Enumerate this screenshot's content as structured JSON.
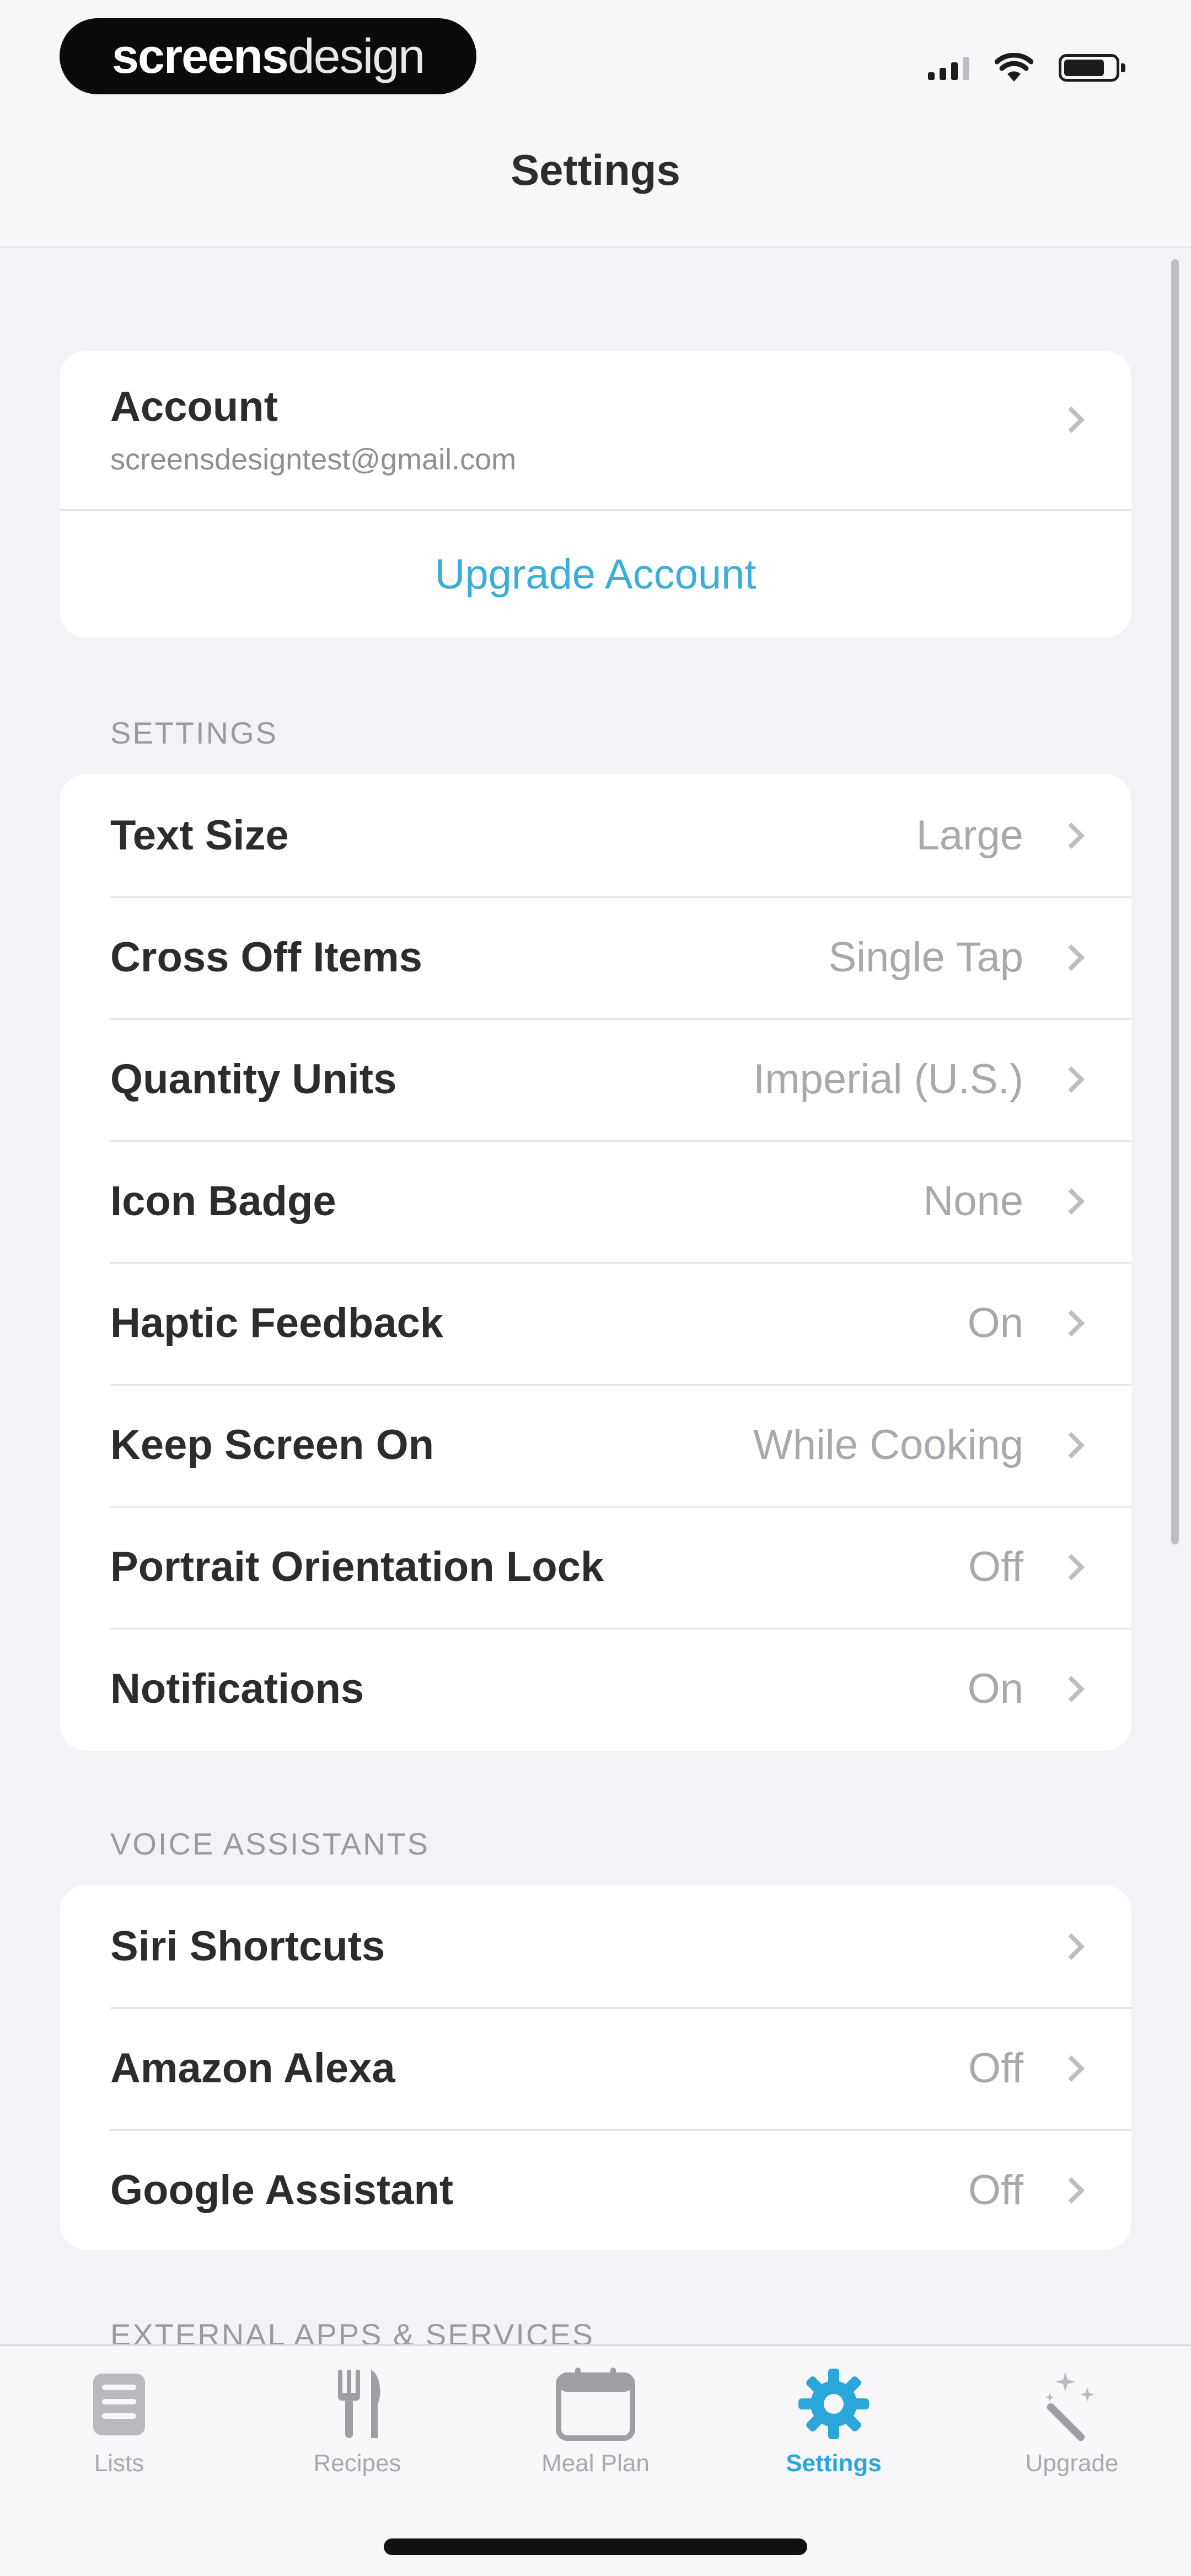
{
  "status_bar": {
    "brand_part1": "screens",
    "brand_part2": "design"
  },
  "nav": {
    "title": "Settings"
  },
  "account": {
    "title": "Account",
    "email": "screensdesigntest@gmail.com",
    "upgrade_label": "Upgrade Account"
  },
  "settings_section": {
    "header": "SETTINGS",
    "rows": [
      {
        "label": "Text Size",
        "value": "Large"
      },
      {
        "label": "Cross Off Items",
        "value": "Single Tap"
      },
      {
        "label": "Quantity Units",
        "value": "Imperial (U.S.)"
      },
      {
        "label": "Icon Badge",
        "value": "None"
      },
      {
        "label": "Haptic Feedback",
        "value": "On"
      },
      {
        "label": "Keep Screen On",
        "value": "While Cooking"
      },
      {
        "label": "Portrait Orientation Lock",
        "value": "Off"
      },
      {
        "label": "Notifications",
        "value": "On"
      }
    ]
  },
  "voice_section": {
    "header": "VOICE ASSISTANTS",
    "rows": [
      {
        "label": "Siri Shortcuts",
        "value": ""
      },
      {
        "label": "Amazon Alexa",
        "value": "Off"
      },
      {
        "label": "Google Assistant",
        "value": "Off"
      }
    ]
  },
  "partial_section": {
    "header": "EXTERNAL APPS & SERVICES"
  },
  "tabs": [
    {
      "label": "Lists",
      "icon": "lists-icon"
    },
    {
      "label": "Recipes",
      "icon": "fork-knife-icon"
    },
    {
      "label": "Meal Plan",
      "icon": "calendar-icon"
    },
    {
      "label": "Settings",
      "icon": "gear-icon",
      "active": true
    },
    {
      "label": "Upgrade",
      "icon": "magic-wand-icon"
    }
  ],
  "colors": {
    "accent": "#2BA6DA",
    "link": "#3AAED8",
    "background": "#F2F2F7",
    "card": "#FFFFFF",
    "secondary_text": "#A8A8AD"
  }
}
